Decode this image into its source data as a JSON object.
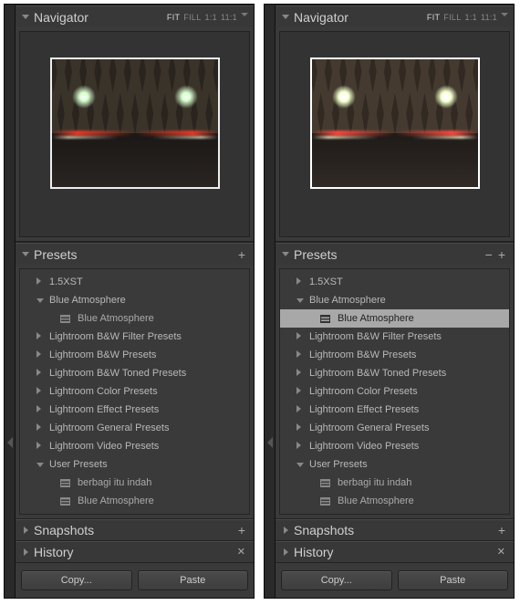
{
  "navigator": {
    "title": "Navigator",
    "modes": [
      "FIT",
      "FILL",
      "1:1",
      "11:1"
    ],
    "active_mode": "FIT"
  },
  "presets": {
    "title": "Presets",
    "folders": [
      {
        "label": "1.5XST",
        "expanded": false,
        "items": []
      },
      {
        "label": "Blue Atmosphere",
        "expanded": true,
        "items": [
          {
            "label": "Blue Atmosphere"
          }
        ]
      },
      {
        "label": "Lightroom B&W Filter Presets",
        "expanded": false,
        "items": []
      },
      {
        "label": "Lightroom B&W Presets",
        "expanded": false,
        "items": []
      },
      {
        "label": "Lightroom B&W Toned Presets",
        "expanded": false,
        "items": []
      },
      {
        "label": "Lightroom Color Presets",
        "expanded": false,
        "items": []
      },
      {
        "label": "Lightroom Effect Presets",
        "expanded": false,
        "items": []
      },
      {
        "label": "Lightroom General Presets",
        "expanded": false,
        "items": []
      },
      {
        "label": "Lightroom Video Presets",
        "expanded": false,
        "items": []
      },
      {
        "label": "User Presets",
        "expanded": true,
        "items": [
          {
            "label": "berbagi itu indah"
          },
          {
            "label": "Blue Atmosphere"
          }
        ]
      }
    ]
  },
  "snapshots": {
    "title": "Snapshots"
  },
  "history": {
    "title": "History"
  },
  "buttons": {
    "copy": "Copy...",
    "paste": "Paste"
  },
  "right_selected_preset": "Blue Atmosphere"
}
